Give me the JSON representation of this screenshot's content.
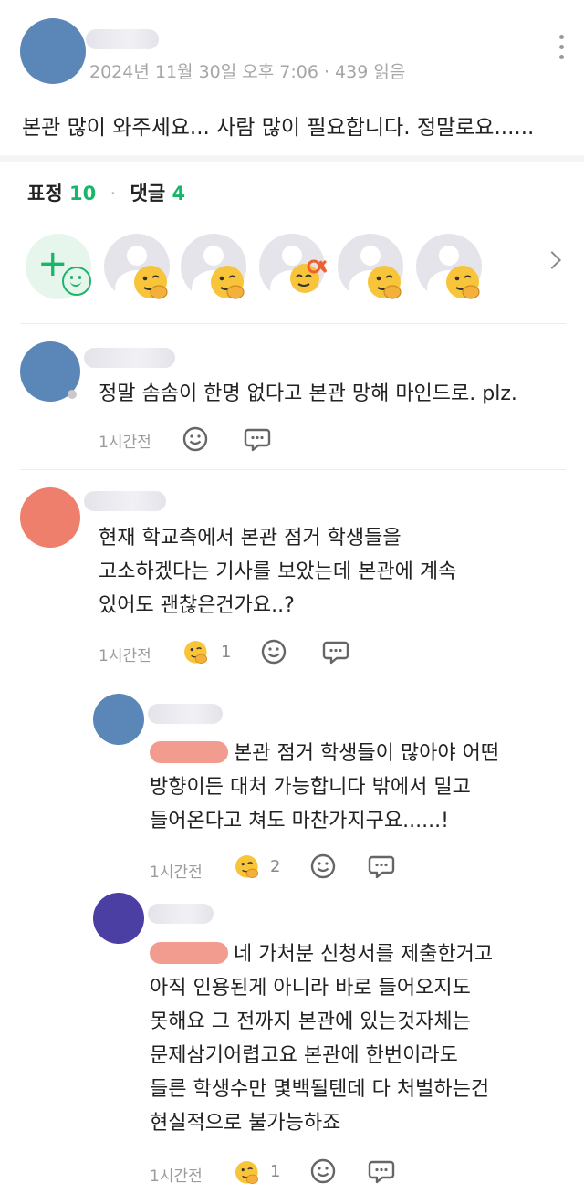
{
  "post": {
    "meta": "2024년 11월 30일 오후 7:06 · 439 읽음",
    "body": "본관 많이 와주세요... 사람 많이 필요합니다. 정말로요......"
  },
  "stats": {
    "reactions_label": "표정",
    "reactions_count": "10",
    "comments_label": "댓글",
    "comments_count": "4"
  },
  "colors": {
    "accent": "#19b66a",
    "avatar_blue": "#5b86b8",
    "avatar_coral": "#ee7f6d",
    "avatar_purple": "#4b3fa3",
    "mention_coral": "#f29b8f"
  },
  "comments": [
    {
      "lines": [
        "정말 솜솜이 한명 없다고 본관 망해 마인드로. plz."
      ],
      "time": "1시간전",
      "reaction_count": ""
    },
    {
      "lines": [
        "현재 학교측에서 본관 점거 학생들을",
        "고소하겠다는 기사를 보았는데 본관에 계속",
        "있어도 괜찮은건가요..?"
      ],
      "time": "1시간전",
      "reaction_count": "1"
    },
    {
      "lines": [
        "본관 점거 학생들이 많아야 어떤",
        "방향이든 대처 가능합니다 밖에서 밀고",
        "들어온다고 쳐도 마찬가지구요......!"
      ],
      "time": "1시간전",
      "reaction_count": "2"
    },
    {
      "lines": [
        "네 가처분 신청서를 제출한거고",
        "아직 인용된게 아니라 바로 들어오지도",
        "못해요 그 전까지 본관에 있는것자체는",
        "문제삼기어렵고요 본관에 한번이라도",
        "들른 학생수만 몇백될텐데 다 처벌하는건",
        "현실적으로 불가능하죠"
      ],
      "time": "1시간전",
      "reaction_count": "1"
    }
  ]
}
